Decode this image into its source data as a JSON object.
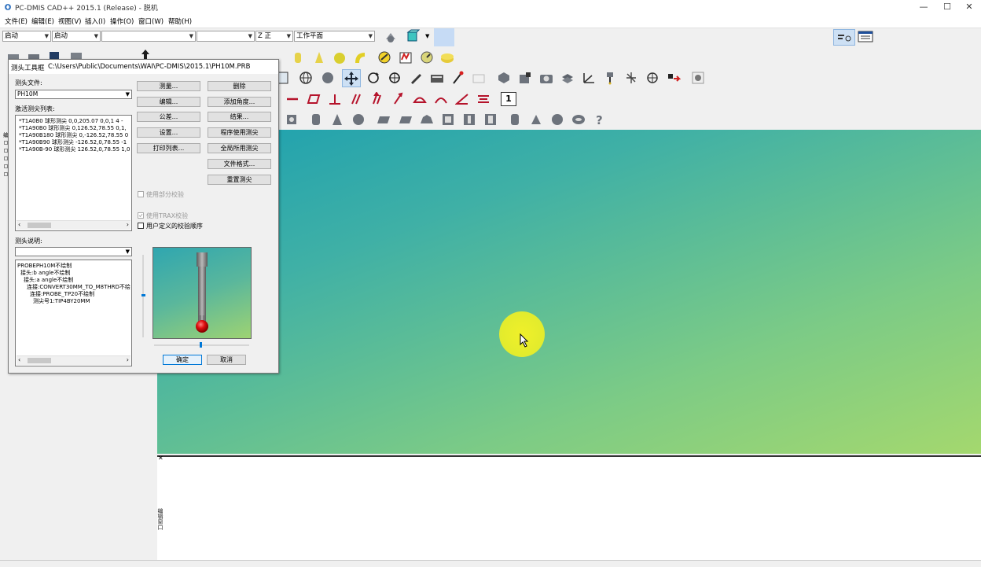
{
  "window": {
    "title": "PC-DMIS CAD++ 2015.1 (Release) - 脱机"
  },
  "menu": [
    "文件(E)",
    "编辑(E)",
    "视图(V)",
    "插入(I)",
    "操作(O)",
    "窗口(W)",
    "帮助(H)"
  ],
  "toolbar": {
    "combo1": "启动",
    "combo2": "启动",
    "combo3": "",
    "combo4": "",
    "view_combo": "Z 正",
    "workplane_combo": "工作平面"
  },
  "dialog": {
    "title": "测头工具框",
    "path": "C:\\Users\\Public\\Documents\\WAI\\PC-DMIS\\2015.1\\PH10M.PRB",
    "probe_file_label": "测头文件:",
    "probe_file_value": "PH10M",
    "active_tips_label": "激活测尖列表:",
    "tips": [
      "*T1A0B0 球形测尖  0,0,205.07 0,0,1 4 -",
      "*T1A90B0 球形测尖  0,126.52,78.55 0,1,",
      "*T1A90B180 球形测尖 0,-126.52,78.55 0",
      "*T1A90B90 球形测尖  -126.52,0,78.55 -1",
      "*T1A90B-90 球形测尖  126.52,0,78.55 1,0"
    ],
    "buttons_left": [
      "测量...",
      "编辑...",
      "公差...",
      "设置...",
      "打印列表..."
    ],
    "buttons_right": [
      "删除",
      "添加角度...",
      "结果...",
      "程序使用测尖",
      "全局所用测尖",
      "文件格式...",
      "重置测尖"
    ],
    "check_partial": "使用部分校验",
    "check_trax": "使用TRAX校验",
    "check_user_order": "用户定义的校验顺序",
    "probe_desc_label": "测头说明:",
    "probe_desc_value": "",
    "tree": [
      "PROBEPH10M不绘制",
      "接头:b angle不绘制",
      "接头:a angle不绘制",
      "连接:CONVERT30MM_TO_M8THRD不绘",
      "连接:PROBE_TP20不绘制",
      "测尖号1:TIP4BY20MM"
    ],
    "ok": "确定",
    "cancel": "取消"
  },
  "lower_pane_label": "编辑窗口",
  "colors": {
    "accent": "#0078d7",
    "probe_tip": "#e01010",
    "highlight": "#e8ee2a"
  }
}
